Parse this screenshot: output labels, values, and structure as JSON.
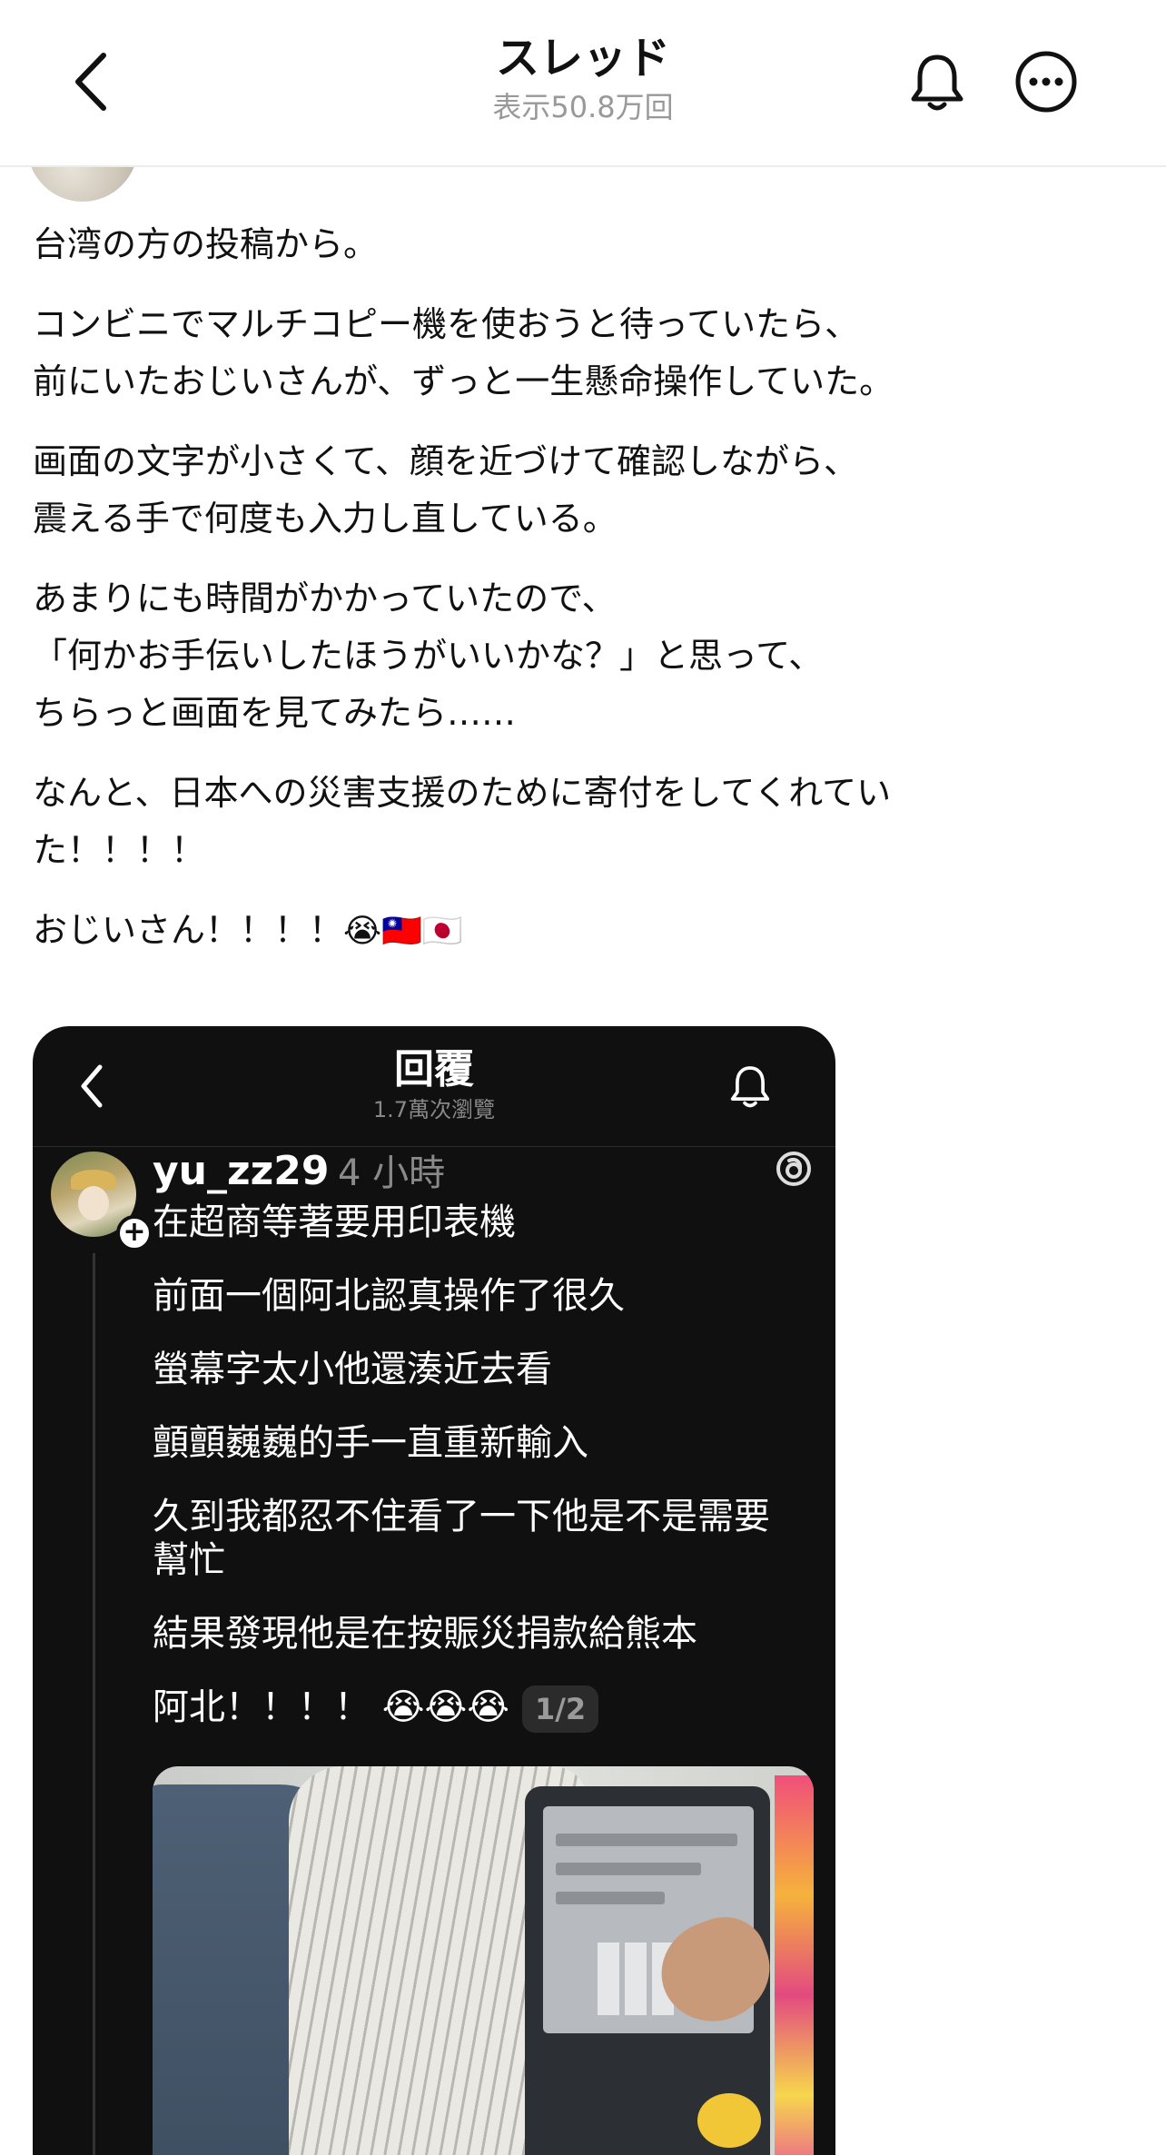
{
  "header": {
    "title": "スレッド",
    "subtitle": "表示50.8万回"
  },
  "icons": {
    "back": "chevron-left-icon",
    "notifications": "bell-icon",
    "more": "more-horizontal-icon"
  },
  "post": {
    "paragraphs": [
      "台湾の方の投稿から。",
      "コンビニでマルチコピー機を使おうと待っていたら、\n前にいたおじいさんが、ずっと一生懸命操作していた。",
      "画面の文字が小さくて、顔を近づけて確認しながら、\n震える手で何度も入力し直している。",
      "あまりにも時間がかかっていたので、\n「何かお手伝いしたほうがいいかな？」と思って、\nちらっと画面を見てみたら……",
      "なんと、日本への災害支援のために寄付をしてくれてい\nた！！！！",
      "おじいさん！！！！"
    ],
    "closing_emojis": "😭🇹🇼🇯🇵"
  },
  "embedded_screenshot": {
    "header_title": "回覆",
    "header_subtitle": "1.7萬次瀏覽",
    "username": "yu_zz29",
    "time": "4 小時",
    "lines": [
      "在超商等著要用印表機",
      "前面一個阿北認真操作了很久",
      "螢幕字太小他還湊近去看",
      "顫顫巍巍的手一直重新輸入",
      "久到我都忍不住看了一下他是不是需要幫忙",
      "結果發現他是在按賑災捐款給熊本",
      "阿北！！！！ 😭😭😭"
    ],
    "page_indicator": "1/2",
    "follow_symbol": "+"
  },
  "colors": {
    "background": "#ffffff",
    "embed_background": "#101010",
    "muted": "#999999"
  }
}
